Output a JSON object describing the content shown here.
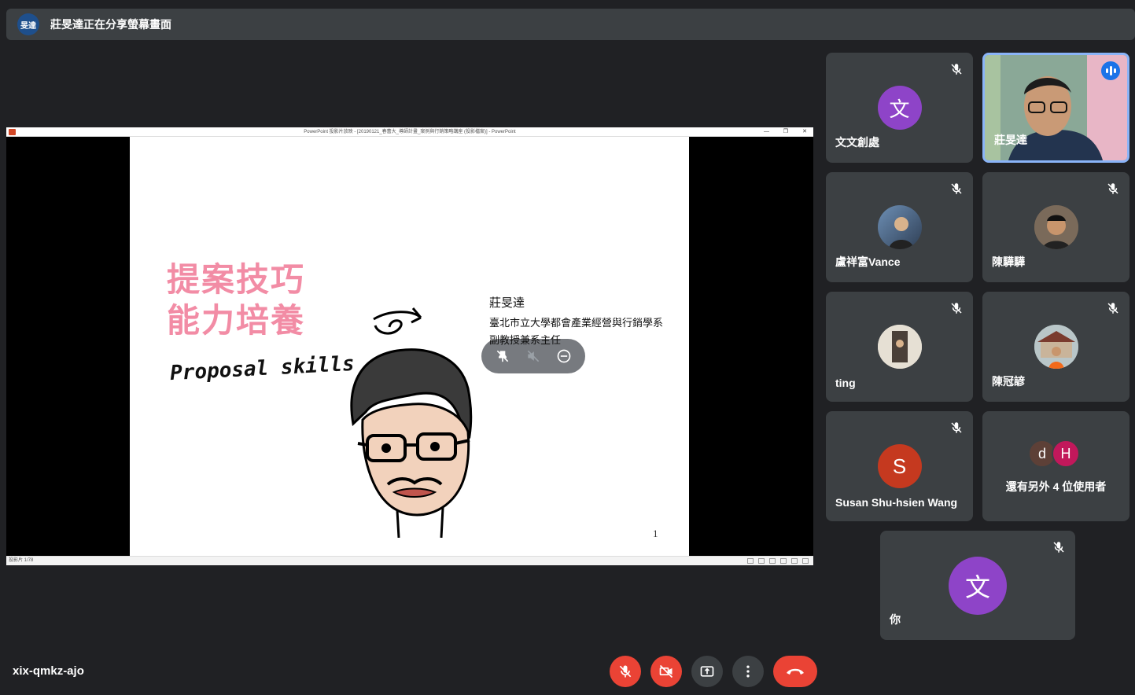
{
  "banner": {
    "avatar_text": "旻達",
    "text": "莊旻達正在分享螢幕畫面"
  },
  "share": {
    "window_title": "PowerPoint 投影片放映 - [20190121_春蕾大_導師計畫_案例與行銷策略講座 (投影檔案)] - PowerPoint",
    "status_text": "投影片 1/78",
    "slide": {
      "title": "提案技巧\n能力培養",
      "subtitle": "Proposal skills",
      "speaker_name": "莊旻達",
      "speaker_affiliation": "臺北市立大學都會產業經營與行銷學系",
      "speaker_position": "副教授兼系主任",
      "page_number": "1"
    }
  },
  "participants": [
    {
      "name": "文文創處",
      "avatar_letter": "文",
      "avatar_color": "#8e44c8",
      "muted": true
    },
    {
      "name": "莊旻達",
      "video": true,
      "speaking": true
    },
    {
      "name": "盧祥富Vance",
      "photo": true,
      "muted": true
    },
    {
      "name": "陳驊驊",
      "photo": true,
      "muted": true
    },
    {
      "name": "ting",
      "photo": true,
      "muted": true
    },
    {
      "name": "陳冠諺",
      "photo": true,
      "muted": true
    },
    {
      "name": "Susan Shu-hsien Wang",
      "avatar_letter": "S",
      "avatar_color": "#c5391f",
      "muted": true
    },
    {
      "name": "還有另外 4 位使用者",
      "more_avatars": [
        "d",
        "H"
      ],
      "more_colors": [
        "#5d4037",
        "#c2185b"
      ]
    },
    {
      "name": "你",
      "avatar_letter": "文",
      "avatar_color": "#8e44c8",
      "muted": true
    }
  ],
  "meeting_code": "xix-qmkz-ajo",
  "colors": {
    "background": "#202124",
    "tile": "#3c4043",
    "accent_red": "#ea4335",
    "speaking_blue": "#1a73e8"
  }
}
